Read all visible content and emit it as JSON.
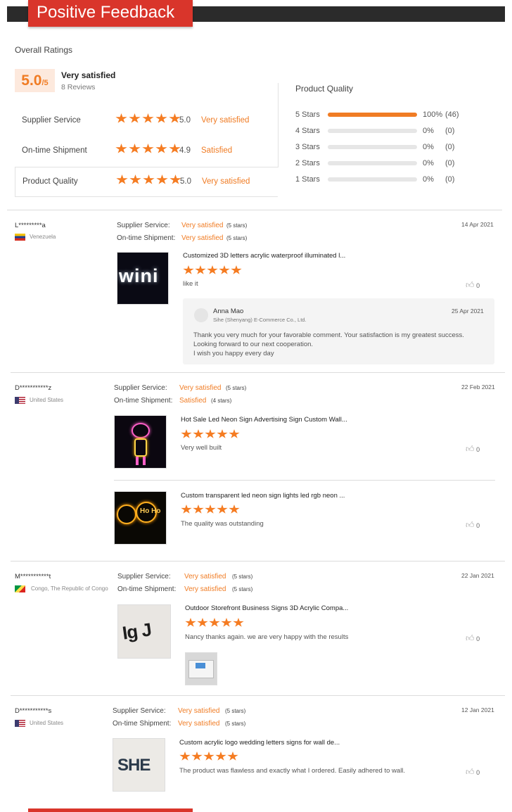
{
  "banner": {
    "title": "Positive Feedback"
  },
  "overall": {
    "heading": "Overall Ratings",
    "score": "5.0",
    "score_suffix": "/5",
    "verdict": "Very satisfied",
    "reviews_count": "8 Reviews",
    "metrics": [
      {
        "label": "Supplier Service",
        "rating": 5,
        "value": "5.0",
        "verdict": "Very satisfied"
      },
      {
        "label": "On-time Shipment",
        "rating": 5,
        "value": "4.9",
        "verdict": "Satisfied"
      },
      {
        "label": "Product Quality",
        "rating": 5,
        "value": "5.0",
        "verdict": "Very satisfied"
      }
    ]
  },
  "distribution": {
    "heading": "Product Quality",
    "rows": [
      {
        "label": "5 Stars",
        "fraction": 1.0,
        "percent": "100%",
        "count": "(46)"
      },
      {
        "label": "4 Stars",
        "fraction": 0,
        "percent": "0%",
        "count": "(0)"
      },
      {
        "label": "3 Stars",
        "fraction": 0,
        "percent": "0%",
        "count": "(0)"
      },
      {
        "label": "2 Stars",
        "fraction": 0,
        "percent": "0%",
        "count": "(0)"
      },
      {
        "label": "1 Stars",
        "fraction": 0,
        "percent": "0%",
        "count": "(0)"
      }
    ]
  },
  "labels": {
    "supplier_service": "Supplier Service:",
    "ontime_shipment": "On-time Shipment:"
  },
  "reviews": [
    {
      "user": "L*********a",
      "country": "Venezuela",
      "date": "14 Apr 2021",
      "supplier_verdict": "Very satisfied",
      "supplier_stars": "(5 stars)",
      "shipment_verdict": "Very satisfied",
      "shipment_stars": "(5 stars)",
      "products": [
        {
          "title": "Customized 3D letters acrylic waterproof illuminated l...",
          "comment": "like it",
          "likes": "0"
        }
      ],
      "reply": {
        "name": "Anna Mao",
        "company": "Sihe (Shenyang) E-Commerce Co., Ltd.",
        "date": "25 Apr 2021",
        "lines": [
          "Thank you very much for your favorable comment. Your satisfaction is my greatest success.",
          "Looking forward to our next cooperation.",
          "I wish you happy every day"
        ]
      }
    },
    {
      "user": "D***********z",
      "country": "United States",
      "date": "22 Feb 2021",
      "supplier_verdict": "Very satisfied",
      "supplier_stars": "(5 stars)",
      "shipment_verdict": "Satisfied",
      "shipment_stars": "(4 stars)",
      "products": [
        {
          "title": "Hot Sale Led Neon Sign Advertising Sign Custom Wall...",
          "comment": "Very well built",
          "likes": "0"
        },
        {
          "title": "Custom transparent led neon sign lights led rgb neon ...",
          "comment": "The quality was outstanding",
          "likes": "0"
        }
      ]
    },
    {
      "user": "M***********t",
      "country": "Congo, The Republic of Congo",
      "date": "22 Jan 2021",
      "supplier_verdict": "Very satisfied",
      "supplier_stars": "(5 stars)",
      "shipment_verdict": "Very satisfied",
      "shipment_stars": "(5 stars)",
      "products": [
        {
          "title": "Outdoor Storefront Business Signs 3D Acrylic Compa...",
          "comment": "Nancy thanks again. we are very happy with the results",
          "likes": "0"
        }
      ]
    },
    {
      "user": "D***********s",
      "country": "United States",
      "date": "12 Jan 2021",
      "supplier_verdict": "Very satisfied",
      "supplier_stars": "(5 stars)",
      "shipment_verdict": "Very satisfied",
      "shipment_stars": "(5 stars)",
      "products": [
        {
          "title": "Custom acrylic logo wedding letters signs for wall de...",
          "comment": "The product was flawless and exactly what I ordered. Easily adhered to wall.",
          "likes": "0"
        }
      ]
    }
  ],
  "colors": {
    "accent": "#f07c24",
    "banner_red": "#d9352b",
    "banner_dark": "#2b2b2b"
  }
}
